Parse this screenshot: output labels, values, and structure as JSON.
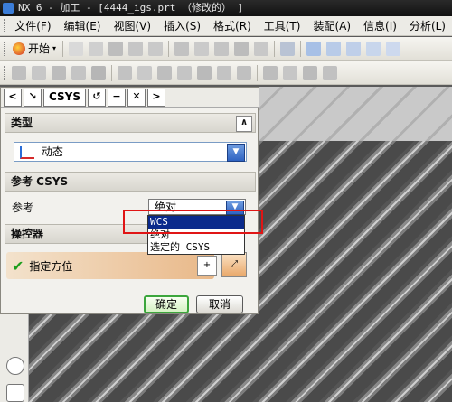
{
  "window": {
    "title": "NX 6 - 加工 - [4444_igs.prt （修改的） ]"
  },
  "menubar": {
    "items": [
      "文件(F)",
      "编辑(E)",
      "视图(V)",
      "插入(S)",
      "格式(R)",
      "工具(T)",
      "装配(A)",
      "信息(I)",
      "分析(L)"
    ]
  },
  "toolbar1": {
    "start_label": "开始"
  },
  "dialog": {
    "header_title": "CSYS",
    "type_section": {
      "title": "类型",
      "value": "动态"
    },
    "ref_section": {
      "title": "参考 CSYS",
      "ref_label": "参考",
      "ref_value": "绝对"
    },
    "manip_section": {
      "title": "操控器",
      "orient_label": "指定方位"
    },
    "buttons": {
      "ok": "确定",
      "cancel": "取消"
    }
  },
  "dropdown": {
    "options": [
      "WCS",
      "绝对",
      "选定的 CSYS"
    ],
    "selected_index": 0
  },
  "colors": {
    "highlight": "#e01515",
    "selection": "#0b2a8c",
    "ok_border": "#3ca63c"
  }
}
